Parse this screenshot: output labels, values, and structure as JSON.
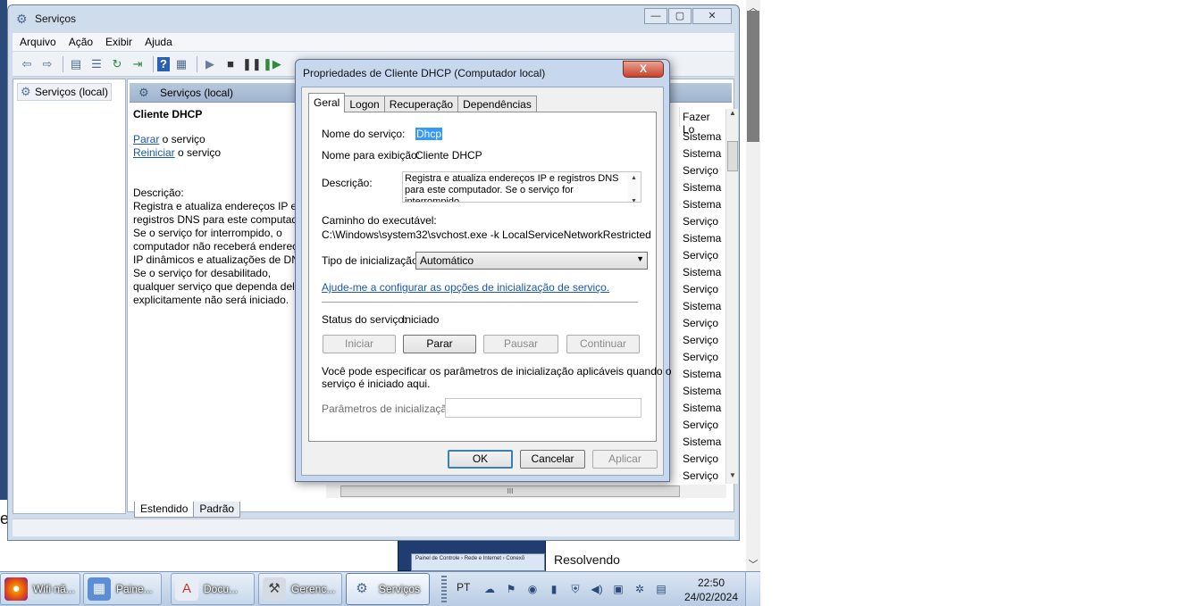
{
  "main_window": {
    "title": "Serviços",
    "menu": [
      "Arquivo",
      "Ação",
      "Exibir",
      "Ajuda"
    ],
    "tree_root": "Serviços (local)",
    "content_header": "Serviços (local)",
    "service_name": "Cliente DHCP",
    "action_stop_link": "Parar",
    "action_stop_suffix": " o serviço",
    "action_restart_link": "Reiniciar",
    "action_restart_suffix": " o serviço",
    "description_label": "Descrição:",
    "description_lines": [
      "Registra e atualiza endereços IP e",
      "registros DNS para este computad",
      "Se o serviço for interrompido, o",
      "computador não receberá endereç",
      "IP dinâmicos e atualizações de DNS",
      "Se o serviço for desabilitado,",
      "qualquer serviço que dependa dele",
      "explicitamente não será iniciado."
    ],
    "list_column_header": "Fazer Lo",
    "list_values": [
      "Sistema",
      "Sistema",
      "Serviço",
      "Sistema",
      "Sistema",
      "Serviço",
      "Sistema",
      "Serviço",
      "Sistema",
      "Serviço",
      "Sistema",
      "Serviço",
      "Serviço",
      "Serviço",
      "Sistema",
      "Sistema",
      "Sistema",
      "Serviço",
      "Sistema",
      "Serviço",
      "Serviço"
    ],
    "bottom_tabs": [
      "Estendido",
      "Padrão"
    ],
    "hscroll_grip": "III"
  },
  "dialog": {
    "title": "Propriedades de Cliente DHCP (Computador local)",
    "close_label": "X",
    "tabs": [
      "Geral",
      "Logon",
      "Recuperação",
      "Dependências"
    ],
    "service_name_label": "Nome do serviço:",
    "service_name_value": "Dhcp",
    "display_name_label": "Nome para exibição:",
    "display_name_value": "Cliente DHCP",
    "description_label": "Descrição:",
    "description_value_line1": "Registra e atualiza endereços IP e registros DNS",
    "description_value_line2": "para este computador. Se o serviço for interrompido,",
    "exe_path_label": "Caminho do executável:",
    "exe_path_value": "C:\\Windows\\system32\\svchost.exe -k LocalServiceNetworkRestricted",
    "startup_type_label": "Tipo de inicialização:",
    "startup_type_value": "Automático",
    "help_link": "Ajude-me a configurar as opções de inicialização de serviço.",
    "status_label": "Status do serviço:",
    "status_value": "Iniciado",
    "btn_start": "Iniciar",
    "btn_stop": "Parar",
    "btn_pause": "Pausar",
    "btn_continue": "Continuar",
    "info_line1": "Você pode especificar os parâmetros de inicialização aplicáveis quando o",
    "info_line2": "serviço é iniciado aqui.",
    "params_label": "Parâmetros de inicialização:",
    "params_value": "",
    "ok": "OK",
    "cancel": "Cancelar",
    "apply": "Aplicar"
  },
  "background": {
    "side_text": "Resolvendo",
    "edge_letter": "e",
    "thumb_caption": "Painel de Controle › Rede e Internet › Conexõ"
  },
  "taskbar": {
    "tasks": [
      {
        "label": "Wifi nã...",
        "icon": "firefox-icon"
      },
      {
        "label": "Paine...",
        "icon": "control-panel-icon"
      },
      {
        "label": "Docu...",
        "icon": "document-icon"
      },
      {
        "label": "Gerenc...",
        "icon": "computer-management-icon"
      },
      {
        "label": "Serviços",
        "icon": "services-icon"
      }
    ],
    "language": "PT",
    "time": "22:50",
    "date": "24/02/2024"
  }
}
